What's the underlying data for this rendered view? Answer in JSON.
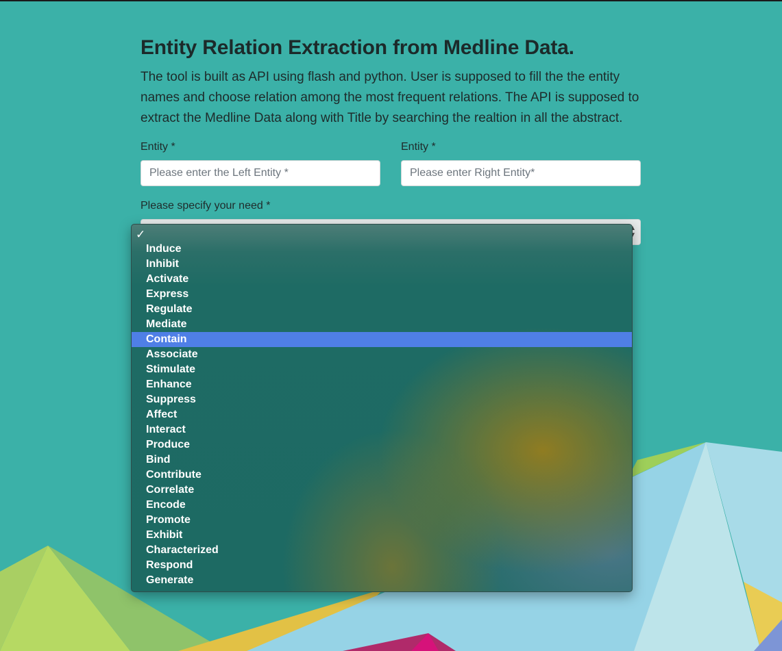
{
  "page": {
    "title": "Entity Relation Extraction from Medline Data.",
    "description": "The tool is built as API using flash and python. User is supposed to fill the the entity names and choose relation among the most frequent relations. The API is supposed to extract the Medline Data along with Title by searching the realtion in all the abstract."
  },
  "form": {
    "left_entity": {
      "label": "Entity *",
      "placeholder": "Please enter the Left Entity *",
      "value": ""
    },
    "right_entity": {
      "label": "Entity *",
      "placeholder": "Please enter Right Entity*",
      "value": ""
    },
    "need": {
      "label": "Please specify your need *",
      "selected": ""
    }
  },
  "dropdown": {
    "checkmark": "✓",
    "highlighted": "Contain",
    "options": [
      "Induce",
      "Inhibit",
      "Activate",
      "Express",
      "Regulate",
      "Mediate",
      "Contain",
      "Associate",
      "Stimulate",
      "Enhance",
      "Suppress",
      "Affect",
      "Interact",
      "Produce",
      "Bind",
      "Contribute",
      "Correlate",
      "Encode",
      "Promote",
      "Exhibit",
      "Characterized",
      "Respond",
      "Generate"
    ]
  },
  "colors": {
    "background": "#3bb1a8",
    "highlight": "#4f7fe6"
  }
}
